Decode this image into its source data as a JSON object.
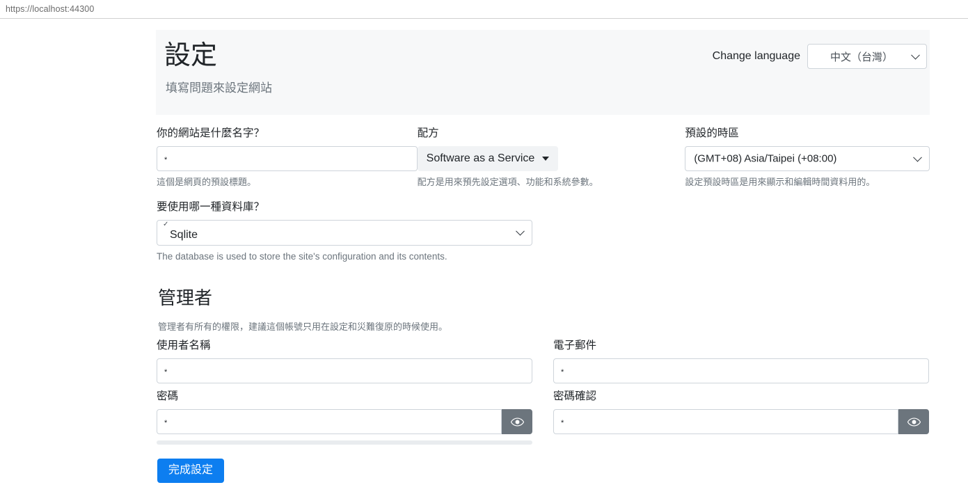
{
  "browser": {
    "url": "https://localhost:44300"
  },
  "header": {
    "title": "設定",
    "subtitle": "填寫問題來設定網站",
    "language_label": "Change language",
    "language_value": "中文（台灣）"
  },
  "fields": {
    "site_name": {
      "label": "你的網站是什麼名字？",
      "value": "*",
      "help": "這個是網頁的預設標題。"
    },
    "recipe": {
      "label": "配方",
      "value": "Software as a Service",
      "help": "配方是用來預先設定選項、功能和系統參數。"
    },
    "timezone": {
      "label": "預設的時區",
      "value": "(GMT+08) Asia/Taipei (+08:00)",
      "help": "設定預設時區是用來顯示和編輯時間資料用的。"
    },
    "database": {
      "label": "要使用哪一種資料庫？",
      "value": "Sqlite",
      "check_glyph": "✓",
      "help": "The database is used to store the site's configuration and its contents."
    }
  },
  "admin": {
    "heading": "管理者",
    "description": "管理者有所有的權限，建議這個帳號只用在設定和災難復原的時候使用。",
    "username": {
      "label": "使用者名稱",
      "value": "*"
    },
    "email": {
      "label": "電子郵件",
      "value": "*"
    },
    "password": {
      "label": "密碼",
      "value": "*",
      "strength_percent": 0
    },
    "password_confirm": {
      "label": "密碼確認",
      "value": "*"
    }
  },
  "submit": {
    "label": "完成設定"
  },
  "colors": {
    "primary": "#0d7ef0",
    "panel": "#f7f8f9",
    "muted": "#6c757d",
    "eye_button": "#6c757d",
    "meter_track": "#e9ecef"
  }
}
